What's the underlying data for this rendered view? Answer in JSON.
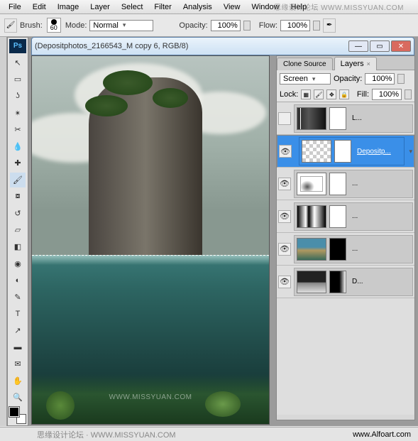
{
  "watermark_top": "思缘设计论坛 WWW.MISSYUAN.COM",
  "watermark_canvas": "WWW.MISSYUAN.COM",
  "menu": {
    "file": "File",
    "edit": "Edit",
    "image": "Image",
    "layer": "Layer",
    "select": "Select",
    "filter": "Filter",
    "analysis": "Analysis",
    "view": "View",
    "window": "Window",
    "help": "Help"
  },
  "options": {
    "brush_label": "Brush:",
    "brush_size": "60",
    "mode_label": "Mode:",
    "mode_value": "Normal",
    "opacity_label": "Opacity:",
    "opacity_value": "100%",
    "flow_label": "Flow:",
    "flow_value": "100%"
  },
  "document": {
    "title": "(Depositphotos_2166543_M copy 6, RGB/8)"
  },
  "panels": {
    "tab_clone": "Clone Source",
    "tab_layers": "Layers",
    "blend_mode": "Screen",
    "opacity_label": "Opacity:",
    "opacity_value": "100%",
    "lock_label": "Lock:",
    "fill_label": "Fill:",
    "fill_value": "100%"
  },
  "layers": [
    {
      "name": "L...",
      "type": "levels",
      "visible": false
    },
    {
      "name": "Depositp...",
      "type": "checker",
      "visible": true,
      "selected": true
    },
    {
      "name": "...",
      "type": "curves",
      "visible": true
    },
    {
      "name": "...",
      "type": "levels2",
      "visible": true
    },
    {
      "name": "...",
      "type": "photo",
      "visible": true
    },
    {
      "name": "D...",
      "type": "bw",
      "visible": true
    }
  ],
  "footer": {
    "left": "思缘设计论坛 · WWW.MISSYUAN.COM",
    "right": "www.Alfoart.com"
  }
}
